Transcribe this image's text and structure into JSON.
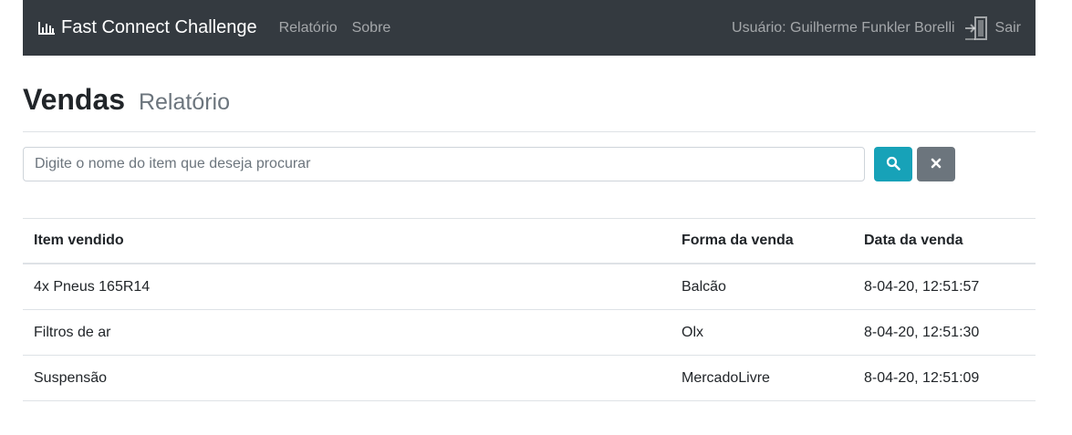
{
  "navbar": {
    "brand": "Fast Connect Challenge",
    "links": [
      "Relatório",
      "Sobre"
    ],
    "user_label": "Usuário: Guilherme Funkler Borelli",
    "logout_label": "Sair"
  },
  "header": {
    "title": "Vendas",
    "subtitle": "Relatório"
  },
  "search": {
    "placeholder": "Digite o nome do item que deseja procurar",
    "value": ""
  },
  "table": {
    "columns": [
      "Item vendido",
      "Forma da venda",
      "Data da venda"
    ],
    "rows": [
      [
        "4x Pneus 165R14",
        "Balcão",
        "8-04-20, 12:51:57"
      ],
      [
        "Filtros de ar",
        "Olx",
        "8-04-20, 12:51:30"
      ],
      [
        "Suspensão",
        "MercadoLivre",
        "8-04-20, 12:51:09"
      ]
    ]
  },
  "icons": {
    "brand": "bar-chart-icon",
    "logout": "door-exit-icon",
    "search": "search-icon",
    "clear": "close-icon"
  },
  "colors": {
    "navbar_bg": "#343a40",
    "search_button": "#17a2b8",
    "clear_button": "#6c757d"
  }
}
